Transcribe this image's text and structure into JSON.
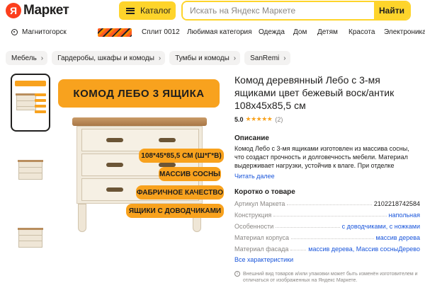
{
  "header": {
    "logo_letter": "Я",
    "logo_text": "Маркет",
    "catalog_label": "Каталог",
    "search_placeholder": "Искать на Яндекс Маркете",
    "search_button": "Найти"
  },
  "subnav": {
    "location": "Магнитогорск",
    "items": [
      "Сплит 0012",
      "Любимая категория",
      "Одежда",
      "Дом",
      "Детям",
      "Красота",
      "Электроника"
    ]
  },
  "breadcrumbs": [
    "Мебель",
    "Гардеробы, шкафы и комоды",
    "Тумбы и комоды",
    "SanRemi"
  ],
  "gallery": {
    "banner": "КОМОД ЛЕБО 3 ЯЩИКА",
    "tags": [
      "108*45*85,5 СМ (Ш*Г*В)",
      "МАССИВ СОСНЫ",
      "ФАБРИЧНОЕ КАЧЕСТВО",
      "ЯЩИКИ С ДОВОДЧИКАМИ"
    ]
  },
  "product": {
    "title": "Комод деревянный Лебо с 3-мя ящиками цвет бежевый воск/антик 108х45х85,5 см",
    "rating": "5.0",
    "stars": "★★★★★",
    "reviews": "(2)",
    "description_heading": "Описание",
    "description": "Комод Лебо с 3-мя ящиками изготовлен из массива сосны, что создаст прочность и долговечность мебели. Материал выдерживает нагрузки, устойчив к влаге. При отделке",
    "read_more": "Читать далее",
    "specs_heading": "Коротко о товаре",
    "specs": [
      {
        "key": "Артикул Маркета",
        "value": "2102218742584"
      },
      {
        "key": "Конструкция",
        "value": "напольная"
      },
      {
        "key": "Особенности",
        "value": "с доводчиками, с ножками"
      },
      {
        "key": "Материал корпуса",
        "value": "массив дерева"
      },
      {
        "key": "Материал фасада",
        "value": "массив дерева, Массив сосныДерево"
      }
    ],
    "all_specs": "Все характеристики",
    "note": "Внешний вид товаров и/или упаковки может быть изменён изготовителем и отличаться от изображенных на Яндекс Маркете."
  },
  "colors": {
    "accent": "#fed42b",
    "tag": "#f8a21e",
    "link": "#1a56db",
    "logo": "#fc3f1d"
  }
}
